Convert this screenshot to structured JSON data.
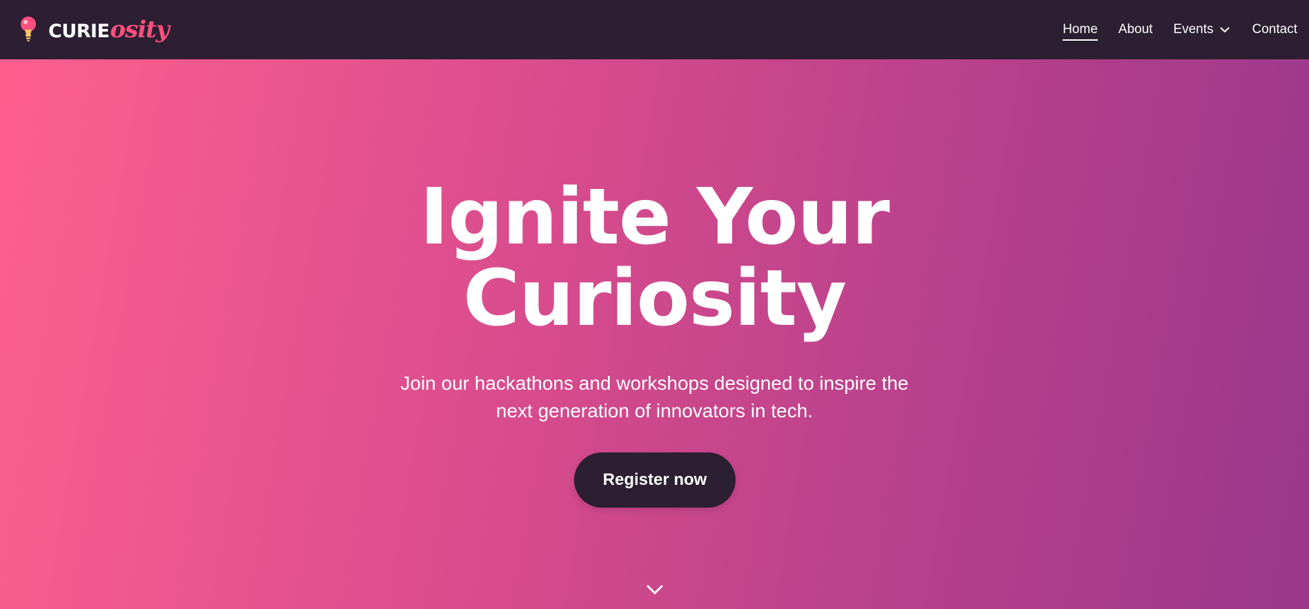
{
  "brand": {
    "name_main": "CURIE",
    "name_script": "osity",
    "accent_color": "#ff4f7f",
    "bulb_icon": "lightbulb-icon"
  },
  "nav": {
    "items": [
      {
        "label": "Home",
        "active": true
      },
      {
        "label": "About",
        "active": false
      },
      {
        "label": "Events",
        "active": false,
        "has_dropdown": true
      },
      {
        "label": "Contact",
        "active": false
      }
    ]
  },
  "hero": {
    "title_line1": "Ignite Your",
    "title_line2": "Curiosity",
    "subtitle_line1": "Join our hackathons and workshops designed to inspire the",
    "subtitle_line2": "next generation of innovators in tech.",
    "cta_label": "Register now",
    "scroll_icon": "chevron-down-icon"
  },
  "colors": {
    "navbar_bg": "#2b1f31",
    "gradient_start": "#ff5f8f",
    "gradient_end": "#9a378b",
    "button_bg": "#2b1f31",
    "text": "#ffffff"
  }
}
